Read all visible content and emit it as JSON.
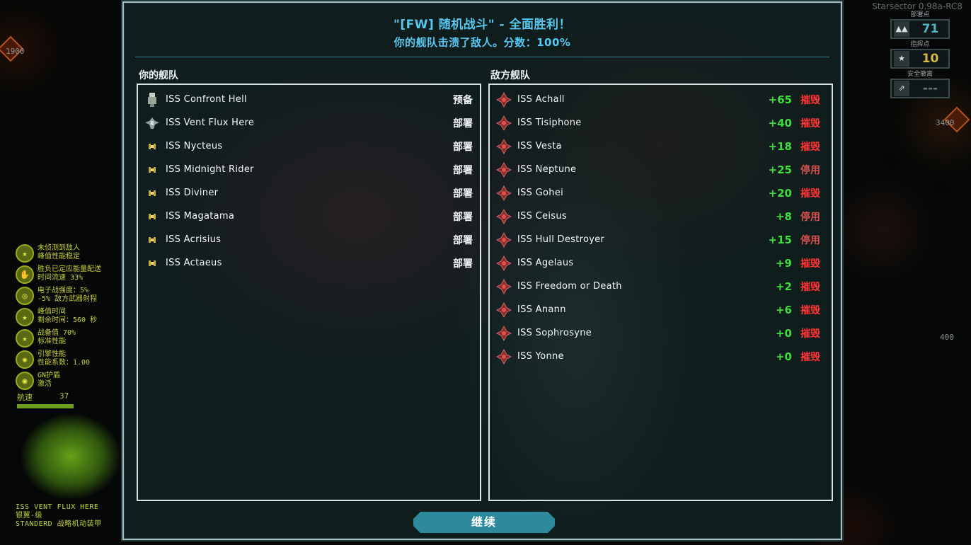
{
  "colors": {
    "title": "#58c7f0",
    "accent_border": "#d9e3e5",
    "points_green": "#3ddd3d",
    "destroyed_red": "#ff3434",
    "disabled_red": "#d85050",
    "button": "#2d8a9c",
    "hud_yellow": "#c8cf3a"
  },
  "background": {
    "version": "Starsector 0.98a-RC8",
    "deployment_points": {
      "label": "部署点",
      "value": "71",
      "value_color": "#4fb3c8"
    },
    "command_points": {
      "label": "指挥点",
      "value": "10",
      "value_color": "#d7b843"
    },
    "safe_withdraw": {
      "label": "安全撤离",
      "value": "---",
      "value_color": "#6a7677"
    },
    "left_hud": [
      {
        "icon": "star-icon",
        "lines": [
          "未侦测到敌人",
          "峰值性能稳定"
        ]
      },
      {
        "icon": "hand-icon",
        "lines": [
          "胜负已定应能量配送",
          "时间流速 33%"
        ]
      },
      {
        "icon": "radar-icon",
        "lines": [
          "电子战强度：5%",
          "-5% 敌方武器射程"
        ]
      },
      {
        "icon": "star-icon",
        "lines": [
          "峰值时间",
          "剩余时间：560 秒"
        ]
      },
      {
        "icon": "star-icon",
        "lines": [
          "战备值 70%",
          "标准性能"
        ]
      },
      {
        "icon": "sun-icon",
        "lines": [
          "引擎性能",
          "性能系数：1.00"
        ]
      },
      {
        "icon": "shield-icon",
        "lines": [
          "GN护盾",
          "激活"
        ]
      }
    ],
    "speed_label": "航速",
    "speed_value": "37",
    "ship_info": [
      "ISS VENT FLUX HERE",
      "银翼-级",
      "STANDERD 战略机动装甲"
    ],
    "edge_numbers": [
      "1900",
      "3400",
      "400"
    ]
  },
  "dialog": {
    "title": "\"[FW] 随机战斗\" - 全面胜利！",
    "subtitle": "你的舰队击溃了敌人。分数：100%",
    "player_fleet_label": "你的舰队",
    "enemy_fleet_label": "敌方舰队",
    "continue_label": "继续"
  },
  "player_fleet": [
    {
      "name": "ISS Confront Hell",
      "status": "预备",
      "icon": "station-ship-icon"
    },
    {
      "name": "ISS Vent Flux Here",
      "status": "部署",
      "icon": "cruiser-ship-icon"
    },
    {
      "name": "ISS Nycteus",
      "status": "部署",
      "icon": "fighter-ship-icon"
    },
    {
      "name": "ISS Midnight Rider",
      "status": "部署",
      "icon": "fighter-ship-icon"
    },
    {
      "name": "ISS Diviner",
      "status": "部署",
      "icon": "fighter-ship-icon"
    },
    {
      "name": "ISS Magatama",
      "status": "部署",
      "icon": "fighter-ship-icon"
    },
    {
      "name": "ISS Acrisius",
      "status": "部署",
      "icon": "fighter-ship-icon"
    },
    {
      "name": "ISS Actaeus",
      "status": "部署",
      "icon": "fighter-ship-icon"
    }
  ],
  "enemy_fleet": [
    {
      "name": "ISS Achall",
      "points": "+65",
      "status": "摧毁",
      "kind": "destroyed"
    },
    {
      "name": "ISS Tisiphone",
      "points": "+40",
      "status": "摧毁",
      "kind": "destroyed"
    },
    {
      "name": "ISS Vesta",
      "points": "+18",
      "status": "摧毁",
      "kind": "destroyed"
    },
    {
      "name": "ISS Neptune",
      "points": "+25",
      "status": "停用",
      "kind": "disabled"
    },
    {
      "name": "ISS Gohei",
      "points": "+20",
      "status": "摧毁",
      "kind": "destroyed"
    },
    {
      "name": "ISS Ceisus",
      "points": "+8",
      "status": "停用",
      "kind": "disabled"
    },
    {
      "name": "ISS Hull Destroyer",
      "points": "+15",
      "status": "停用",
      "kind": "disabled"
    },
    {
      "name": "ISS Agelaus",
      "points": "+9",
      "status": "摧毁",
      "kind": "destroyed"
    },
    {
      "name": "ISS Freedom or Death",
      "points": "+2",
      "status": "摧毁",
      "kind": "destroyed"
    },
    {
      "name": "ISS Anann",
      "points": "+6",
      "status": "摧毁",
      "kind": "destroyed"
    },
    {
      "name": "ISS Sophrosyne",
      "points": "+0",
      "status": "摧毁",
      "kind": "destroyed"
    },
    {
      "name": "ISS Yonne",
      "points": "+0",
      "status": "摧毁",
      "kind": "destroyed"
    }
  ]
}
